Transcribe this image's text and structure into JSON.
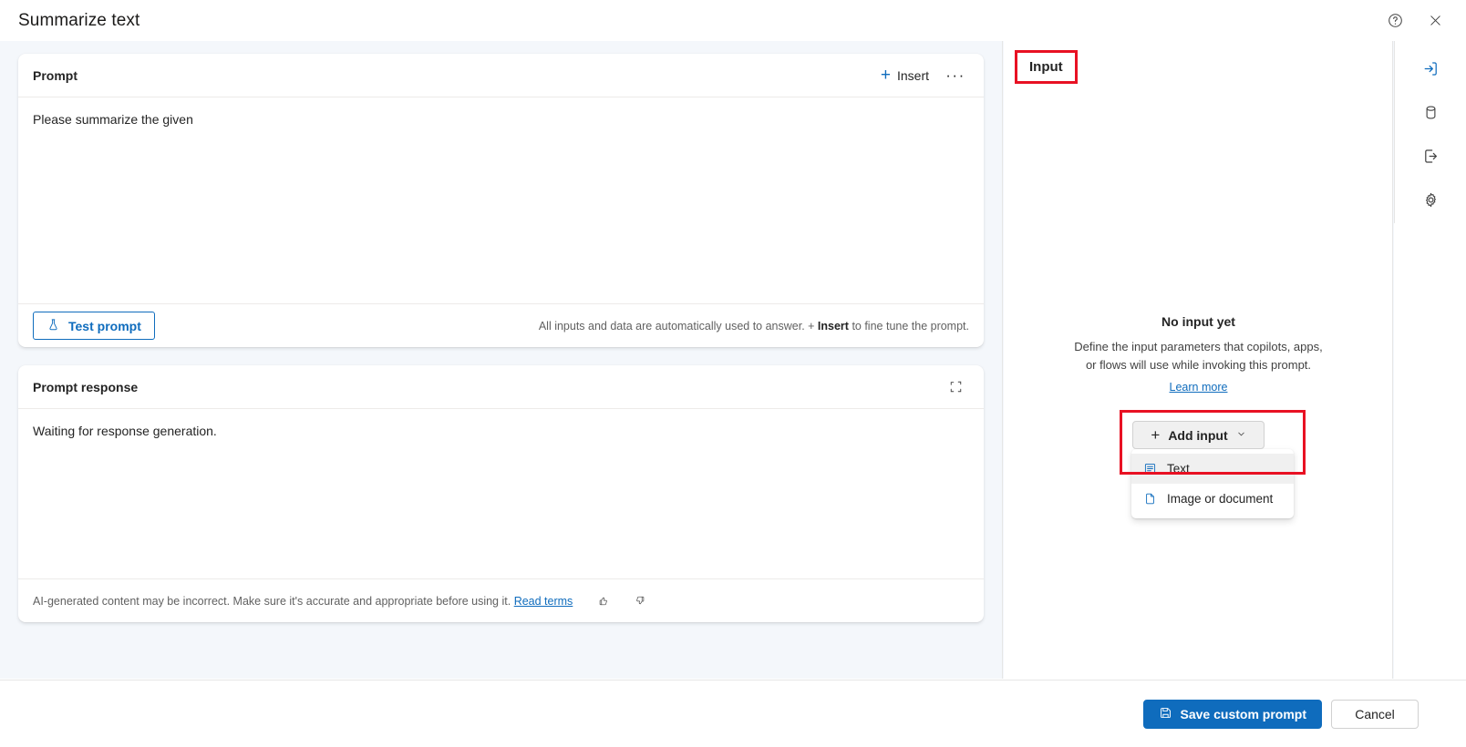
{
  "window": {
    "title": "Summarize text",
    "help_icon": "help-circle-icon",
    "close_icon": "close-icon"
  },
  "prompt_card": {
    "title": "Prompt",
    "insert_label": "Insert",
    "more_label": "···",
    "text": "Please summarize the given",
    "test_button_label": "Test prompt",
    "hint_prefix": "All inputs and data are automatically used to answer. + ",
    "hint_bold": "Insert",
    "hint_suffix": " to fine tune the prompt."
  },
  "response_card": {
    "title": "Prompt response",
    "expand_icon": "expand-icon",
    "text": "Waiting for response generation.",
    "disclaimer": "AI-generated content may be incorrect. Make sure it's accurate and appropriate before using it. ",
    "read_terms_label": "Read terms",
    "thumbs_up_icon": "thumbs-up-icon",
    "thumbs_down_icon": "thumbs-down-icon"
  },
  "input_panel": {
    "header": "Input",
    "empty_title": "No input yet",
    "empty_desc_line1": "Define the input parameters that copilots, apps,",
    "empty_desc_line2": "or flows will use while invoking this prompt.",
    "learn_more_label": "Learn more",
    "add_input_label": "Add input",
    "menu_items": [
      {
        "label": "Text",
        "icon": "text-lines-icon",
        "selected": true
      },
      {
        "label": "Image or document",
        "icon": "document-icon",
        "selected": false
      }
    ]
  },
  "rail": {
    "items": [
      {
        "name": "input-icon",
        "active": true
      },
      {
        "name": "database-icon",
        "active": false
      },
      {
        "name": "output-icon",
        "active": false
      },
      {
        "name": "settings-gear-icon",
        "active": false
      }
    ]
  },
  "footer": {
    "save_label": "Save custom prompt",
    "save_icon": "save-disk-icon",
    "cancel_label": "Cancel"
  },
  "colors": {
    "accent": "#0f6cbd",
    "highlight": "#e81123",
    "canvas": "#f4f7fb"
  }
}
